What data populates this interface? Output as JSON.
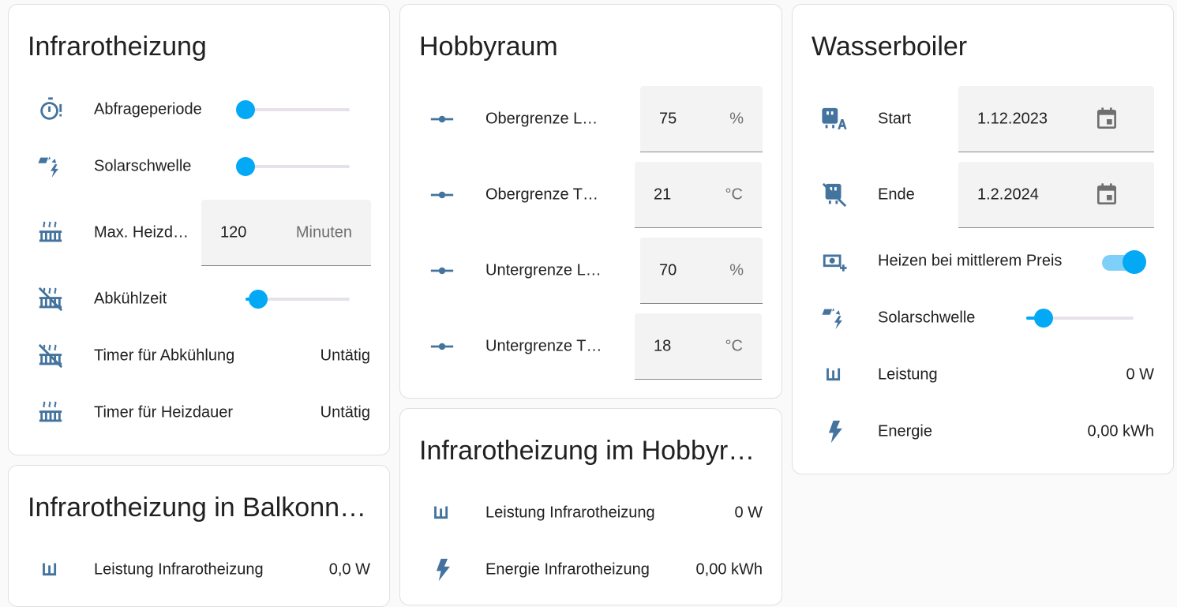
{
  "colors": {
    "accent": "#03a9f4",
    "icon": "#44739e",
    "card_bg": "#ffffff",
    "page_bg": "#fafafa"
  },
  "infrarotheizung": {
    "title": "Infrarotheizung",
    "rows": [
      {
        "icon": "timer-alert-icon",
        "label": "Abfrageperiode",
        "slider_level": 0.0
      },
      {
        "icon": "solar-power-icon",
        "label": "Solarschwelle",
        "slider_level": 0.0
      },
      {
        "icon": "radiator-icon",
        "label": "Max. Heizd…",
        "value": "120",
        "unit": "Minuten"
      },
      {
        "icon": "radiator-off-icon",
        "label": "Abkühlzeit",
        "slider_level": 0.1
      },
      {
        "icon": "radiator-off-icon",
        "label": "Timer für Abkühlung",
        "value": "Untätig"
      },
      {
        "icon": "radiator-icon",
        "label": "Timer für Heizdauer",
        "value": "Untätig"
      }
    ]
  },
  "balkon": {
    "title": "Infrarotheizung in Balkonn…",
    "rows": [
      {
        "icon": "power-w-icon",
        "label": "Leistung Infrarotheizung",
        "value": "0,0 W"
      }
    ]
  },
  "hobbyraum": {
    "title": "Hobbyraum",
    "rows": [
      {
        "icon": "ray-vertex-icon",
        "label": "Obergrenze L…",
        "value": "75",
        "unit": "%"
      },
      {
        "icon": "ray-vertex-icon",
        "label": "Obergrenze T…",
        "value": "21",
        "unit": "°C"
      },
      {
        "icon": "ray-vertex-icon",
        "label": "Untergrenze L…",
        "value": "70",
        "unit": "%"
      },
      {
        "icon": "ray-vertex-icon",
        "label": "Untergrenze T…",
        "value": "18",
        "unit": "°C"
      }
    ]
  },
  "hobby_infra": {
    "title": "Infrarotheizung im Hobbyr…",
    "rows": [
      {
        "icon": "power-w-icon",
        "label": "Leistung Infrarotheizung",
        "value": "0 W"
      },
      {
        "icon": "flash-icon",
        "label": "Energie Infrarotheizung",
        "value": "0,00 kWh"
      }
    ]
  },
  "wasserboiler": {
    "title": "Wasserboiler",
    "rows": [
      {
        "icon": "water-boiler-auto-icon",
        "label": "Start",
        "value": "1.12.2023"
      },
      {
        "icon": "water-boiler-off-icon",
        "label": "Ende",
        "value": "1.2.2024"
      },
      {
        "icon": "cash-plus-icon",
        "label": "Heizen bei mittlerem Preis",
        "toggle": "on"
      },
      {
        "icon": "solar-power-icon",
        "label": "Solarschwelle",
        "slider_level": 0.15
      },
      {
        "icon": "power-w-icon",
        "label": "Leistung",
        "value": "0 W"
      },
      {
        "icon": "flash-icon",
        "label": "Energie",
        "value": "0,00 kWh"
      }
    ]
  }
}
